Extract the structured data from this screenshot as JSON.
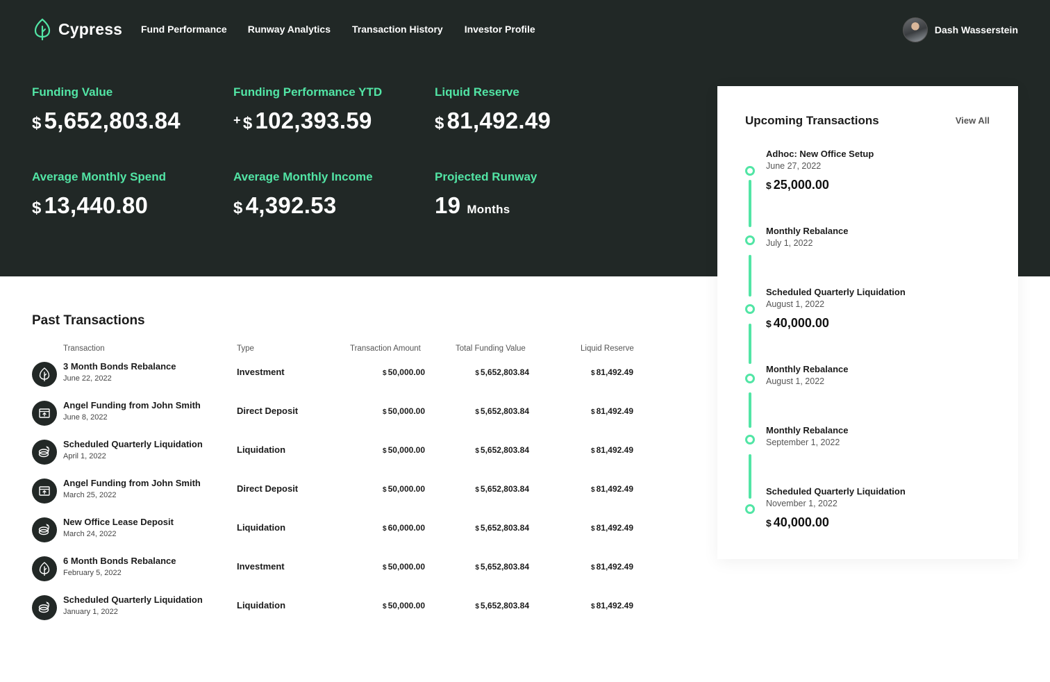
{
  "brand": {
    "name": "Cypress",
    "accent": "#52e5a5",
    "dark": "#212826"
  },
  "nav": [
    "Fund Performance",
    "Runway Analytics",
    "Transaction History",
    "Investor Profile"
  ],
  "user": {
    "name": "Dash Wasserstein"
  },
  "stats": {
    "funding_value": {
      "label": "Funding Value",
      "currency": "$",
      "value": "5,652,803.84"
    },
    "funding_ytd": {
      "label": "Funding Performance YTD",
      "sign": "+",
      "currency": "$",
      "value": "102,393.59"
    },
    "liquid_reserve": {
      "label": "Liquid Reserve",
      "currency": "$",
      "value": "81,492.49"
    },
    "avg_spend": {
      "label": "Average Monthly Spend",
      "currency": "$",
      "value": "13,440.80"
    },
    "avg_income": {
      "label": "Average Monthly Income",
      "currency": "$",
      "value": "4,392.53"
    },
    "runway": {
      "label": "Projected Runway",
      "value": "19",
      "unit": "Months"
    }
  },
  "upcoming": {
    "title": "Upcoming Transactions",
    "view_all": "View All",
    "items": [
      {
        "name": "Adhoc: New Office Setup",
        "date": "June 27, 2022",
        "currency": "$",
        "amount": "25,000.00"
      },
      {
        "name": "Monthly Rebalance",
        "date": "July 1, 2022"
      },
      {
        "name": "Scheduled Quarterly Liquidation",
        "date": "August 1, 2022",
        "currency": "$",
        "amount": "40,000.00"
      },
      {
        "name": "Monthly Rebalance",
        "date": "August 1, 2022"
      },
      {
        "name": "Monthly Rebalance",
        "date": "September 1, 2022"
      },
      {
        "name": "Scheduled Quarterly Liquidation",
        "date": "November 1, 2022",
        "currency": "$",
        "amount": "40,000.00"
      }
    ]
  },
  "past": {
    "title": "Past Transactions",
    "headers": {
      "transaction": "Transaction",
      "type": "Type",
      "amount": "Transaction Amount",
      "total": "Total Funding Value",
      "liquid": "Liquid Reserve"
    },
    "currency": "$",
    "rows": [
      {
        "icon": "tree-icon",
        "name": "3 Month Bonds Rebalance",
        "date": "June 22, 2022",
        "type": "Investment",
        "amount": "50,000.00",
        "total": "5,652,803.84",
        "liquid": "81,492.49"
      },
      {
        "icon": "deposit-icon",
        "name": "Angel Funding from John Smith",
        "date": "June 8, 2022",
        "type": "Direct Deposit",
        "amount": "50,000.00",
        "total": "5,652,803.84",
        "liquid": "81,492.49"
      },
      {
        "icon": "coins-icon",
        "name": "Scheduled Quarterly Liquidation",
        "date": "April 1, 2022",
        "type": "Liquidation",
        "amount": "50,000.00",
        "total": "5,652,803.84",
        "liquid": "81,492.49"
      },
      {
        "icon": "deposit-icon",
        "name": "Angel Funding from John Smith",
        "date": "March 25, 2022",
        "type": "Direct Deposit",
        "amount": "50,000.00",
        "total": "5,652,803.84",
        "liquid": "81,492.49"
      },
      {
        "icon": "coins-icon",
        "name": "New Office Lease Deposit",
        "date": "March 24, 2022",
        "type": "Liquidation",
        "amount": "60,000.00",
        "total": "5,652,803.84",
        "liquid": "81,492.49"
      },
      {
        "icon": "tree-icon",
        "name": "6 Month Bonds Rebalance",
        "date": "February 5, 2022",
        "type": "Investment",
        "amount": "50,000.00",
        "total": "5,652,803.84",
        "liquid": "81,492.49"
      },
      {
        "icon": "coins-icon",
        "name": "Scheduled Quarterly Liquidation",
        "date": "January 1, 2022",
        "type": "Liquidation",
        "amount": "50,000.00",
        "total": "5,652,803.84",
        "liquid": "81,492.49"
      }
    ]
  }
}
